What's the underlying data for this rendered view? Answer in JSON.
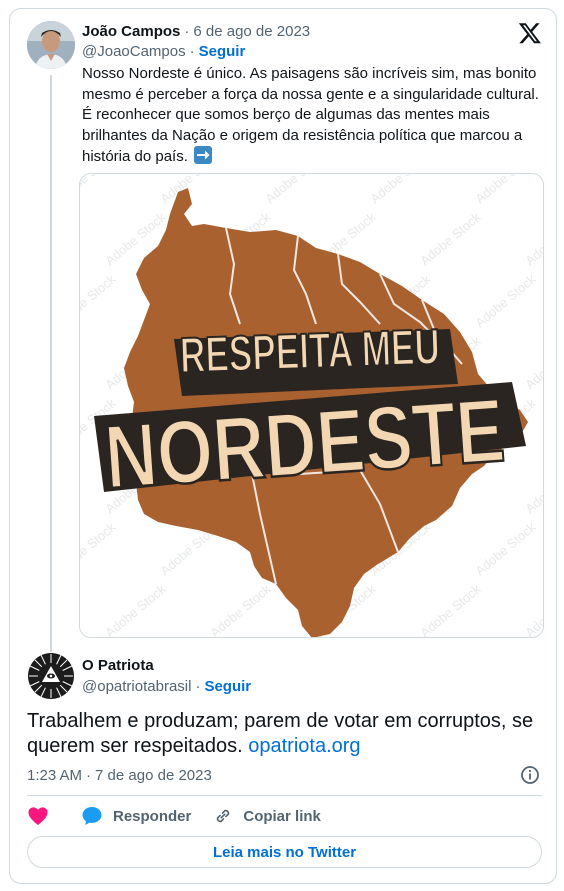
{
  "quoted_tweet": {
    "author_name": "João Campos",
    "separator": "·",
    "date": "6 de ago de 2023",
    "handle": "@JoaoCampos",
    "follow_label": "Seguir",
    "text": "Nosso Nordeste é único. As paisagens são incríveis sim, mas bonito mesmo é perceber a força da nossa gente e a singularidade cultural. É reconhecer que somos berço de algumas das mentes mais brilhantes da Nação e origem da resistência política que marcou a história do país.",
    "emoji": "arrow-right-emoji",
    "media": {
      "line1": "RESPEITA MEU",
      "line2": "NORDESTE",
      "watermark": "Adobe Stock",
      "map_color": "#a8612f",
      "letter_color": "#f3d7b3"
    }
  },
  "main_tweet": {
    "author_name": "O Patriota",
    "handle": "@opatriotabrasil",
    "separator": "·",
    "follow_label": "Seguir",
    "text": "Trabalhem e produzam; parem de votar em corruptos, se querem ser respeitados.",
    "link": "opatriota.org",
    "time": "1:23 AM",
    "date": "7 de ago de 2023"
  },
  "actions": {
    "reply_label": "Responder",
    "copy_label": "Copiar link",
    "read_more_label": "Leia mais no Twitter"
  },
  "icons": {
    "logo": "x-logo-icon",
    "info": "info-icon",
    "like": "heart-icon",
    "reply": "speech-bubble-icon",
    "copy": "link-icon"
  },
  "colors": {
    "link": "#006fd6",
    "like": "#f91880",
    "reply": "#1d9bf0",
    "muted": "#536471",
    "border": "#cfd9de"
  }
}
